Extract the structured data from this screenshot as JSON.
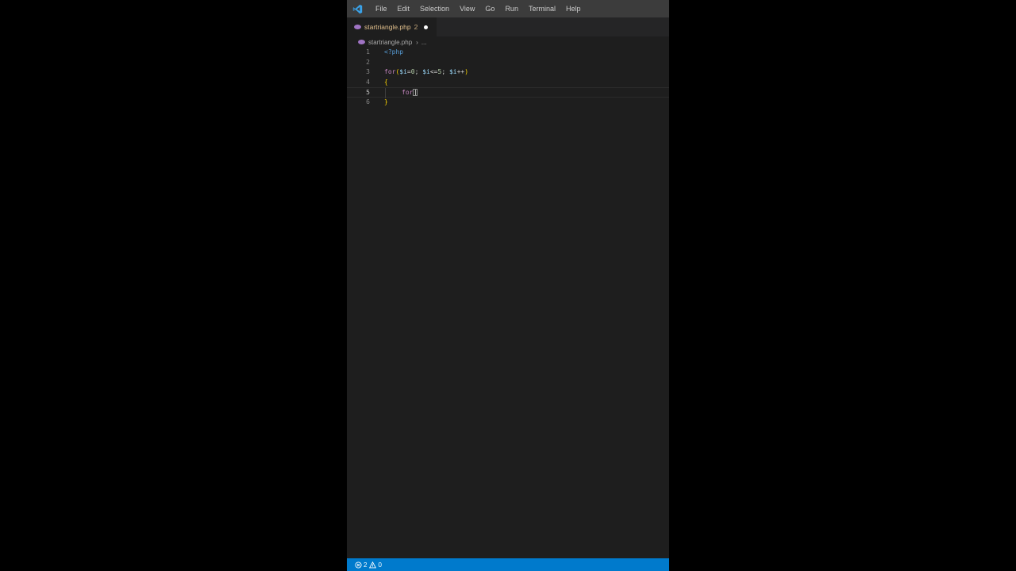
{
  "menu": [
    "File",
    "Edit",
    "Selection",
    "View",
    "Go",
    "Run",
    "Terminal",
    "Help"
  ],
  "tab": {
    "filename": "startriangle.php",
    "problem_count": "2"
  },
  "breadcrumb": {
    "file": "startriangle.php",
    "more": "..."
  },
  "editor": {
    "line_numbers": [
      "1",
      "2",
      "3",
      "4",
      "5",
      "6"
    ],
    "current_line": "5"
  },
  "status": {
    "errors": "2",
    "warnings": "0"
  },
  "colors": {
    "accent": "#007acc",
    "tab_text": "#e2c08d",
    "php_icon": "#a074c4"
  },
  "icons": [
    "vscode-icon",
    "php-file-icon",
    "error-icon",
    "warning-icon"
  ]
}
